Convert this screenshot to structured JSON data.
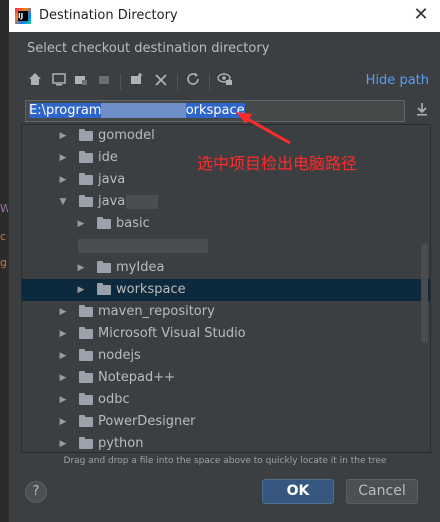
{
  "window": {
    "title": "Destination Directory"
  },
  "heading": "Select checkout destination directory",
  "toolbar": {
    "icons": [
      "home-icon",
      "desktop-icon",
      "project-icon",
      "module-icon",
      "new-folder-icon",
      "delete-icon",
      "refresh-icon",
      "show-hidden-icon"
    ],
    "hide_path_label": "Hide path"
  },
  "path": {
    "value_start": "E:\\program",
    "value_end": "orkspace"
  },
  "tree": {
    "items": [
      {
        "label": "gomodel",
        "expanded": false
      },
      {
        "label": "ide",
        "expanded": false
      },
      {
        "label": "java",
        "expanded": false
      },
      {
        "label": "java",
        "expanded": true
      },
      {
        "label": "basic",
        "expanded": false
      },
      {
        "label": "myIdea",
        "expanded": false
      },
      {
        "label": "workspace",
        "expanded": false,
        "selected": true
      },
      {
        "label": "maven_repository",
        "expanded": false
      },
      {
        "label": "Microsoft Visual Studio",
        "expanded": false
      },
      {
        "label": "nodejs",
        "expanded": false
      },
      {
        "label": "Notepad++",
        "expanded": false
      },
      {
        "label": "odbc",
        "expanded": false
      },
      {
        "label": "PowerDesigner",
        "expanded": false
      },
      {
        "label": "python",
        "expanded": false
      }
    ]
  },
  "annotation": "选中项目检出电脑路径",
  "hint": "Drag and drop a file into the space above to quickly locate it in the tree",
  "buttons": {
    "help": "?",
    "ok": "OK",
    "cancel": "Cancel"
  },
  "colors": {
    "background": "#3c3f41",
    "selection": "#0d293e",
    "link": "#589df6",
    "annotation": "#ff2a2a",
    "ok_button": "#365880"
  }
}
